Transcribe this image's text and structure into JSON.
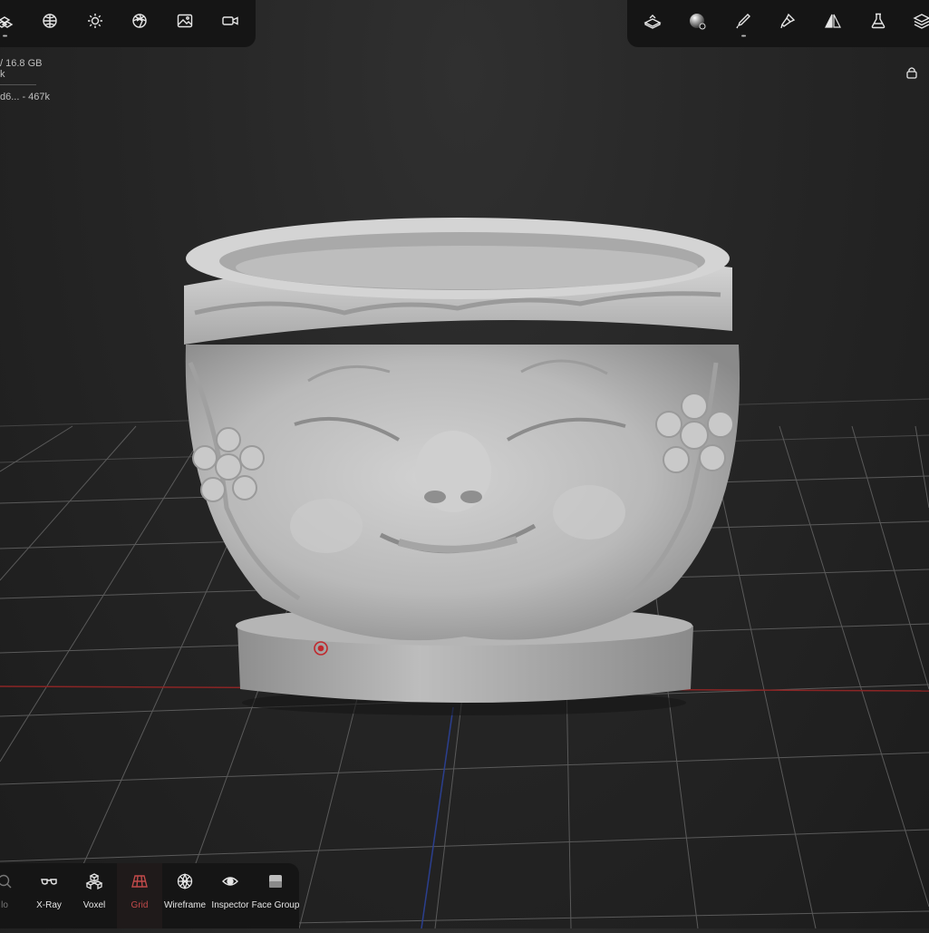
{
  "top_left_toolbar": {
    "buttons": [
      {
        "icon": "scene-icon",
        "has_menu": true
      },
      {
        "icon": "matcap-sphere-icon"
      },
      {
        "icon": "light-icon"
      },
      {
        "icon": "shading-icon"
      },
      {
        "icon": "background-image-icon"
      },
      {
        "icon": "camera-icon"
      }
    ]
  },
  "top_right_toolbar": {
    "buttons": [
      {
        "icon": "scene-objects-icon"
      },
      {
        "icon": "material-sphere-icon",
        "has_menu": true
      },
      {
        "icon": "brush-icon",
        "has_menu": true
      },
      {
        "icon": "paint-icon"
      },
      {
        "icon": "symmetry-icon"
      },
      {
        "icon": "flask-icon"
      },
      {
        "icon": "layers-icon"
      }
    ]
  },
  "info_panel": {
    "memory": "/ 16.8 GB",
    "line2": "k",
    "mesh": "d6... - 467k"
  },
  "bottom_toolbar": {
    "buttons": [
      {
        "label": "lo",
        "icon": "search-icon",
        "faded": true
      },
      {
        "label": "X-Ray",
        "icon": "xray-icon"
      },
      {
        "label": "Voxel",
        "icon": "voxel-icon"
      },
      {
        "label": "Grid",
        "icon": "grid-icon",
        "active": true
      },
      {
        "label": "Wireframe",
        "icon": "wireframe-icon"
      },
      {
        "label": "Inspector",
        "icon": "inspector-icon"
      },
      {
        "label": "Face Group",
        "icon": "face-group-icon"
      }
    ]
  },
  "colors": {
    "accent": "#c24a4a",
    "toolbar_bg": "#151515",
    "grid_line": "#5e5e5e",
    "axis_x": "#8b2525",
    "axis_z": "#2b3f8e",
    "model": "#c4c4c4"
  }
}
